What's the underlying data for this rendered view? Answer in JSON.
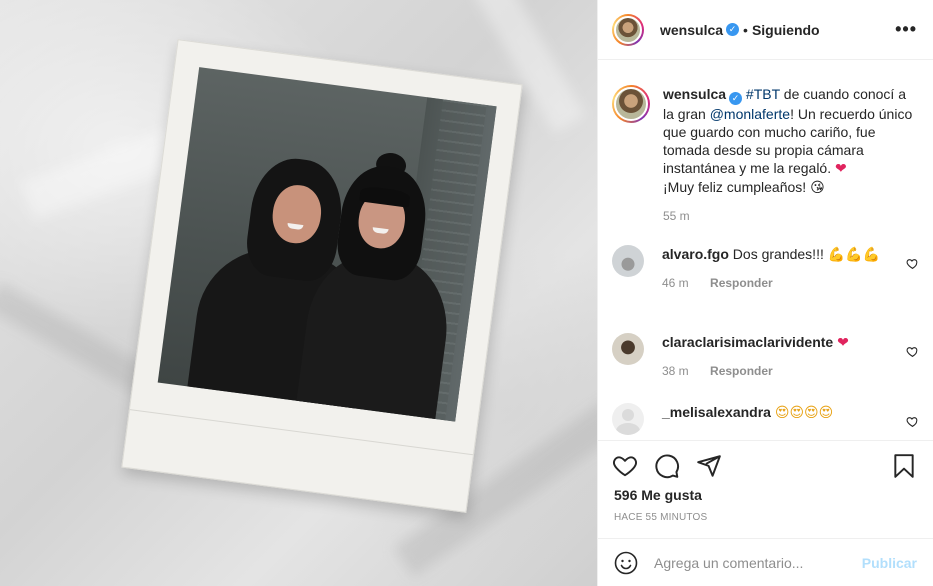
{
  "header": {
    "username": "wensulca",
    "separator": "•",
    "follow_status": "Siguiendo",
    "more": "•••"
  },
  "caption": {
    "username": "wensulca",
    "hashtag": "#TBT",
    "text1": " de cuando conocí a la gran ",
    "mention": "@monlaferte",
    "text2": "! Un recuerdo único que guardo con mucho cariño, fue tomada desde su propia cámara instantánea y me la regaló. ",
    "heart": "❤",
    "text3": "¡Muy feliz cumpleaños! ",
    "kiss": "😘",
    "time": "55 m"
  },
  "comments": [
    {
      "username": "alvaro.fgo",
      "text": "Dos grandes!!! ",
      "emoji": "💪💪💪",
      "time": "46 m",
      "reply": "Responder"
    },
    {
      "username": "claraclarisimaclarividente",
      "text": " ",
      "emoji": "❤",
      "time": "38 m",
      "reply": "Responder"
    },
    {
      "username": "_melisalexandra",
      "text": " ",
      "emoji": "😍😍😍😍",
      "time": "",
      "reply": ""
    }
  ],
  "post": {
    "likes": "596 Me gusta",
    "ago": "HACE 55 MINUTOS"
  },
  "add_comment": {
    "placeholder": "Agrega un comentario...",
    "publish": "Publicar"
  },
  "colors": {
    "link": "#00376b",
    "verified": "#3897f0",
    "muted": "#8e8e8e",
    "publish_disabled": "#b2dffc"
  },
  "icons": [
    "emoji-icon",
    "heart-icon",
    "comment-icon",
    "share-icon",
    "bookmark-icon",
    "more-icon",
    "verified-icon"
  ]
}
